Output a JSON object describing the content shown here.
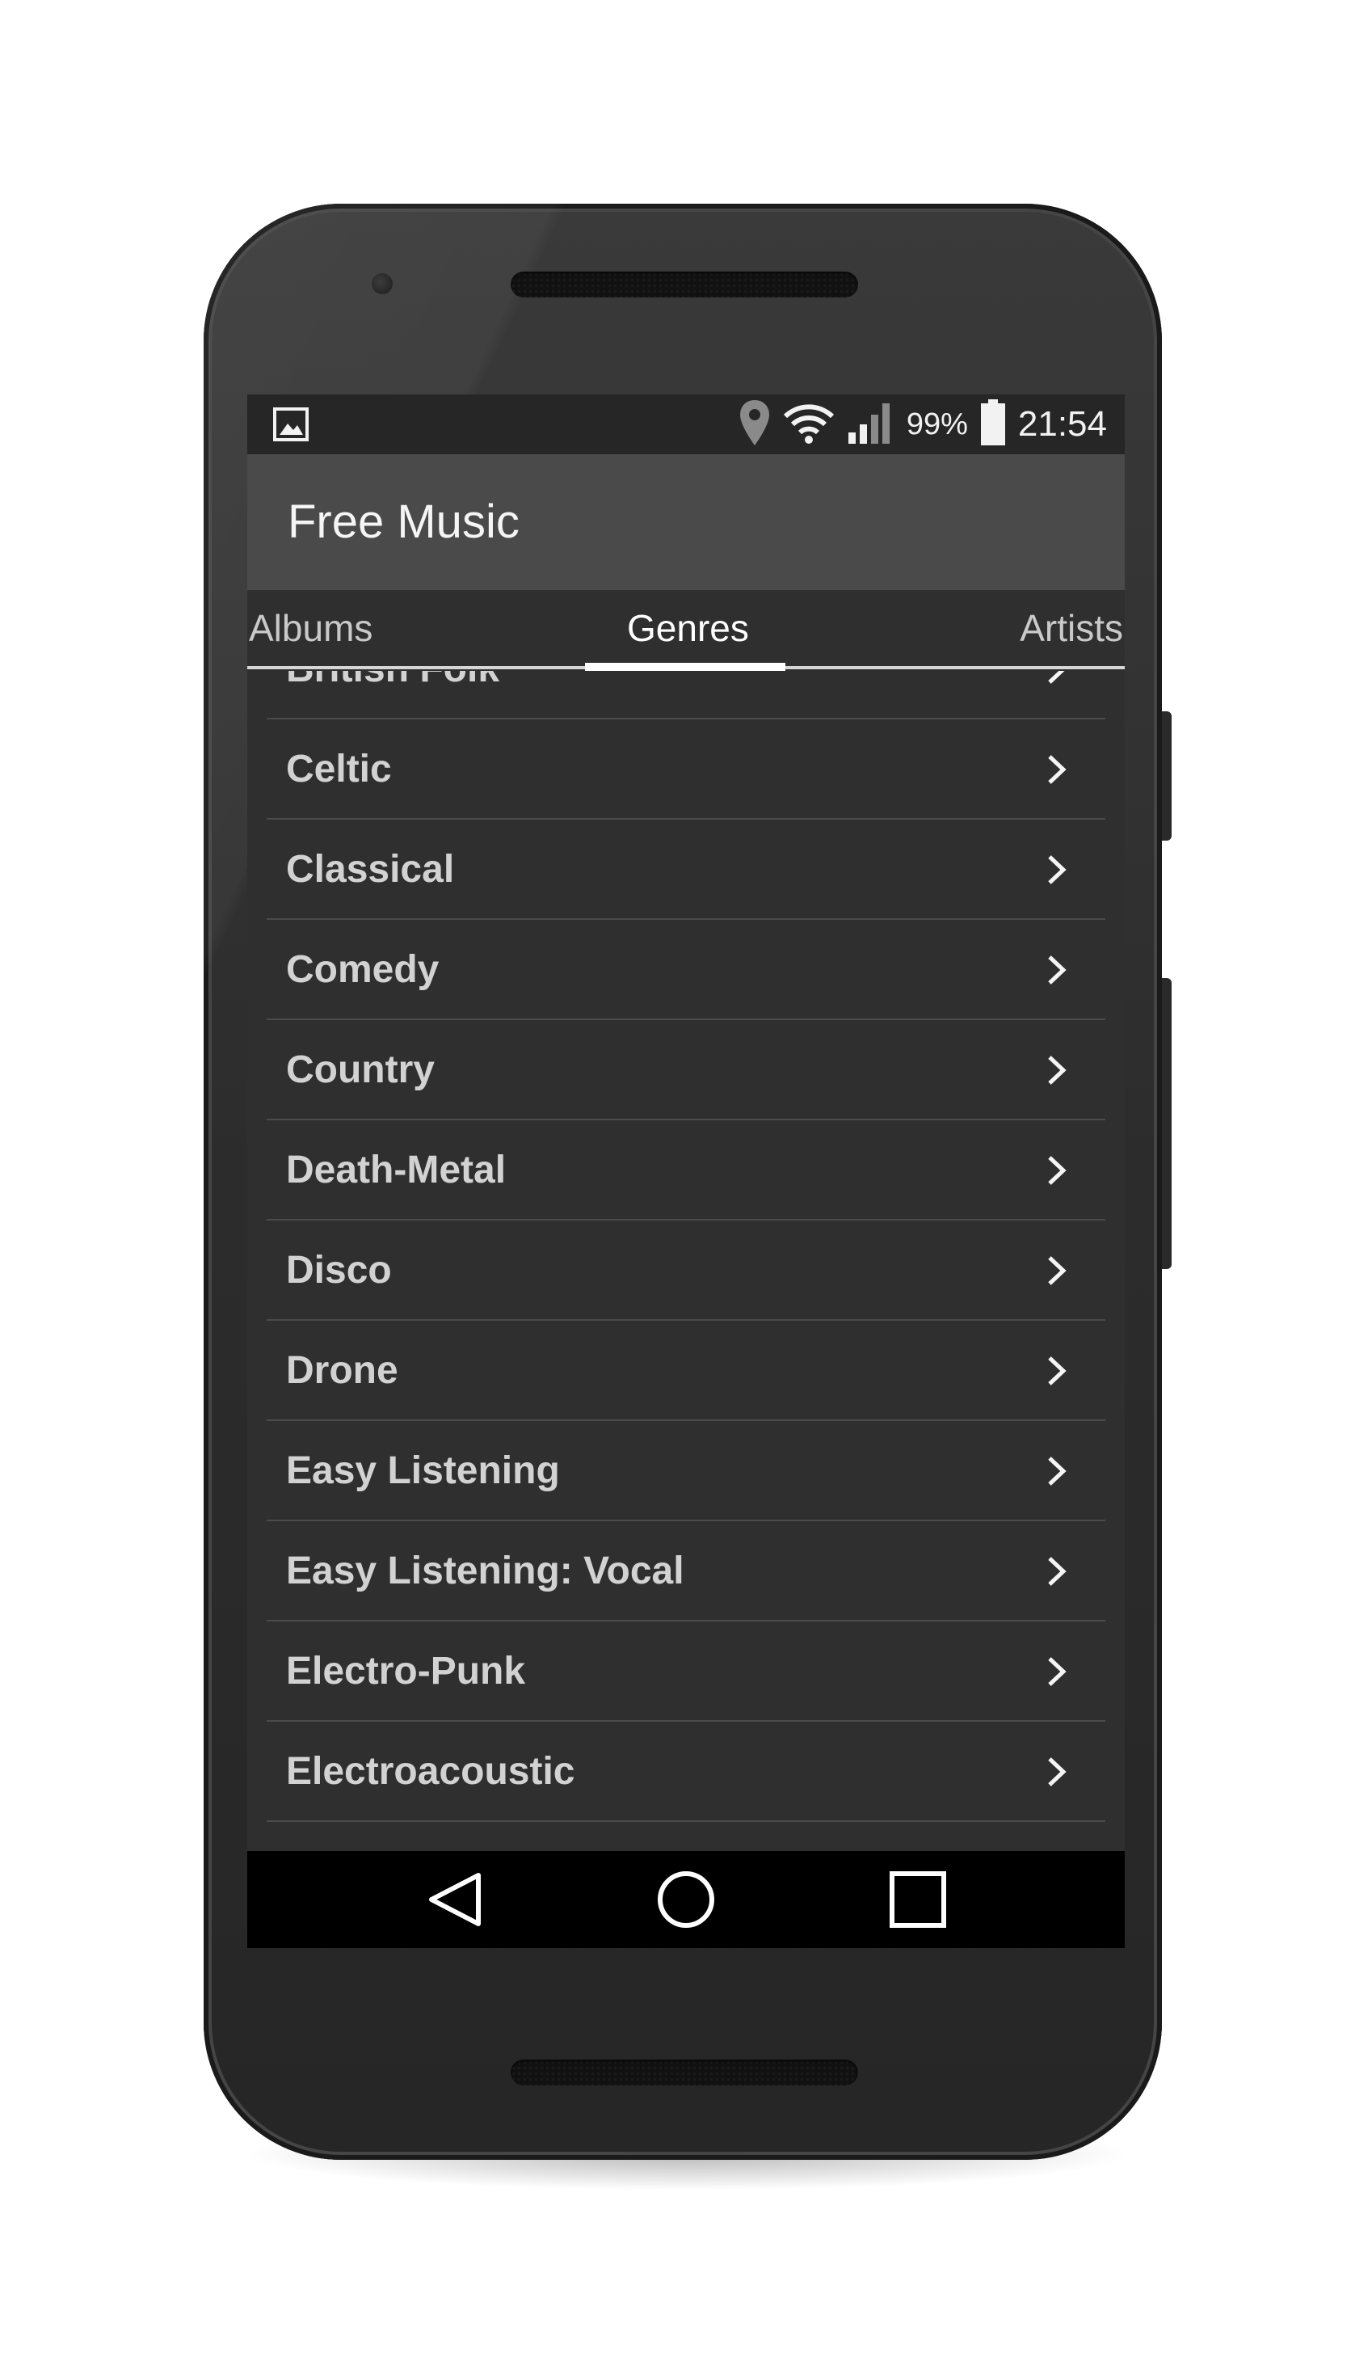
{
  "status_bar": {
    "battery_percent": "99%",
    "time": "21:54",
    "icons": [
      "image-icon",
      "location-icon",
      "wifi-icon",
      "signal-icon",
      "battery-icon"
    ]
  },
  "app_bar": {
    "title": "Free Music"
  },
  "tabs": [
    {
      "label": "Albums",
      "active": false
    },
    {
      "label": "Genres",
      "active": true
    },
    {
      "label": "Artists",
      "active": false
    }
  ],
  "genres": [
    "British Folk",
    "Celtic",
    "Classical",
    "Comedy",
    "Country",
    "Death-Metal",
    "Disco",
    "Drone",
    "Easy Listening",
    "Easy Listening: Vocal",
    "Electro-Punk",
    "Electroacoustic"
  ],
  "nav_bar": {
    "icons": [
      "back-icon",
      "home-icon",
      "recents-icon"
    ]
  }
}
